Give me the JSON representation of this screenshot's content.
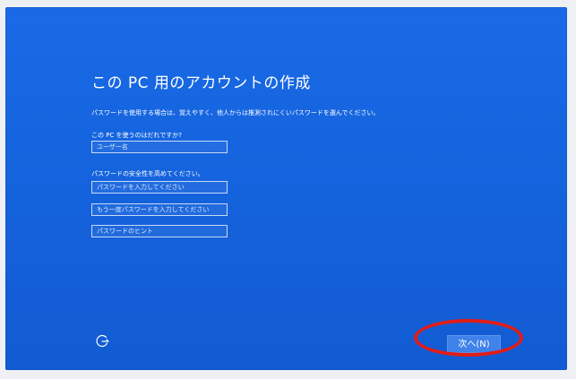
{
  "page": {
    "title": "この PC 用のアカウントの作成",
    "description": "パスワードを使用する場合は、覚えやすく、他人からは推測されにくいパスワードを選んでください。"
  },
  "form": {
    "username_label": "この PC を使うのはだれですか?",
    "username_placeholder": "ユーザー名",
    "password_label": "パスワードの安全性を高めてください。",
    "password_placeholder": "パスワードを入力してください",
    "password_confirm_placeholder": "もう一度パスワードを入力してください",
    "password_hint_placeholder": "パスワードのヒント"
  },
  "footer": {
    "ease_of_access_icon": "ease-of-access-icon",
    "next_label": "次へ(N)"
  },
  "colors": {
    "background": "#1766e0",
    "button": "#3f82ea",
    "highlight": "#e11d18"
  }
}
